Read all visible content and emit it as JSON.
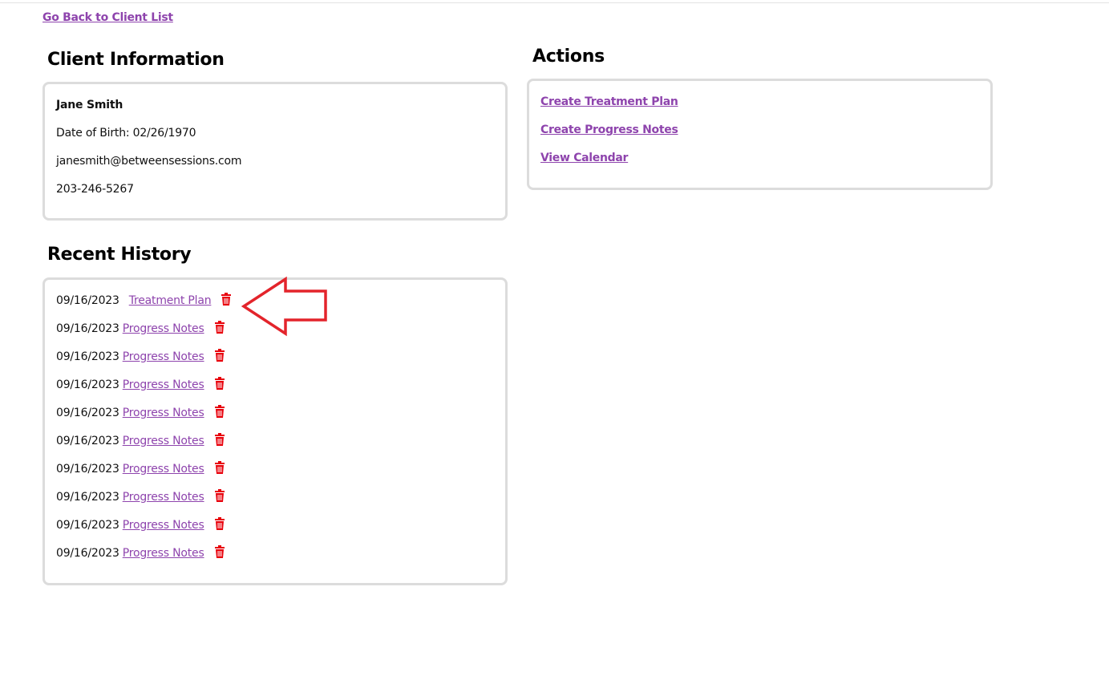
{
  "nav": {
    "back_label": "Go Back to Client List"
  },
  "client_info": {
    "title": "Client Information",
    "name": "Jane Smith",
    "dob": "Date of Birth: 02/26/1970",
    "email": "janesmith@betweensessions.com",
    "phone": "203-246-5267"
  },
  "actions": {
    "title": "Actions",
    "items": [
      {
        "label": "Create Treatment Plan"
      },
      {
        "label": "Create Progress Notes"
      },
      {
        "label": "View Calendar"
      }
    ]
  },
  "history": {
    "title": "Recent History",
    "items": [
      {
        "date": "09/16/2023",
        "label": "Treatment Plan"
      },
      {
        "date": "09/16/2023",
        "label": "Progress Notes"
      },
      {
        "date": "09/16/2023",
        "label": "Progress Notes"
      },
      {
        "date": "09/16/2023",
        "label": "Progress Notes"
      },
      {
        "date": "09/16/2023",
        "label": "Progress Notes"
      },
      {
        "date": "09/16/2023",
        "label": "Progress Notes"
      },
      {
        "date": "09/16/2023",
        "label": "Progress Notes"
      },
      {
        "date": "09/16/2023",
        "label": "Progress Notes"
      },
      {
        "date": "09/16/2023",
        "label": "Progress Notes"
      },
      {
        "date": "09/16/2023",
        "label": "Progress Notes"
      }
    ]
  },
  "colors": {
    "link": "#8e44ad",
    "delete_icon": "#e8000b",
    "annotation_arrow": "#e3242b",
    "card_border": "#dcdcdc"
  },
  "icons": {
    "delete": "trash-icon",
    "annotation": "arrow-left-annotation"
  }
}
